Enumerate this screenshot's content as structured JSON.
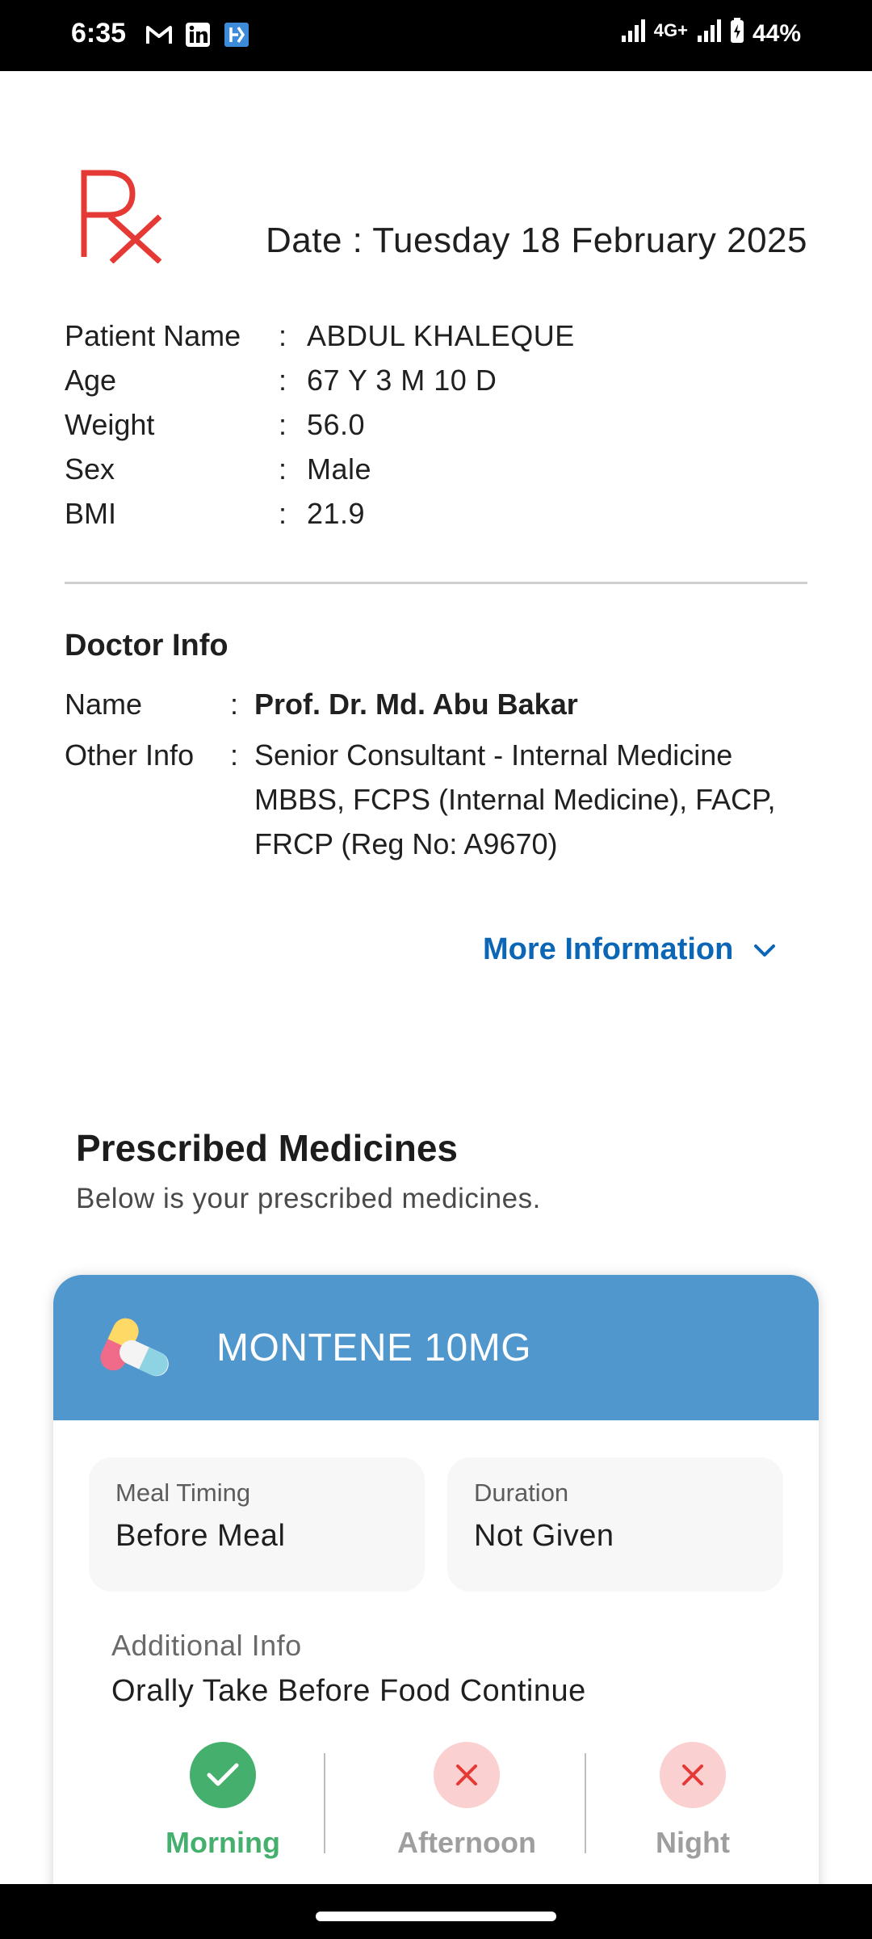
{
  "status_bar": {
    "time": "6:35",
    "network": "4G+",
    "battery": "44%",
    "app_icons": [
      "gmail-icon",
      "linkedin-icon",
      "app-icon"
    ]
  },
  "rx_symbol": "Rx",
  "date_line": "Date : Tuesday 18 February 2025",
  "patient": {
    "rows": [
      {
        "label": "Patient Name",
        "value": "ABDUL KHALEQUE"
      },
      {
        "label": "Age",
        "value": "67 Y 3 M 10 D"
      },
      {
        "label": "Weight",
        "value": "56.0"
      },
      {
        "label": "Sex",
        "value": "Male"
      },
      {
        "label": "BMI",
        "value": "21.9"
      }
    ]
  },
  "doctor": {
    "title": "Doctor Info",
    "name_label": "Name",
    "name": "Prof. Dr. Md. Abu Bakar",
    "other_label": "Other Info",
    "other_lines": [
      "Senior Consultant - Internal Medicine",
      "MBBS, FCPS (Internal Medicine), FACP,",
      "FRCP (Reg No: A9670)"
    ]
  },
  "more_info_label": "More Information",
  "prescribed": {
    "title": "Prescribed Medicines",
    "subtitle": "Below is your prescribed medicines."
  },
  "medicine": {
    "name": "MONTENE 10MG",
    "meal_timing_label": "Meal Timing",
    "meal_timing": "Before Meal",
    "duration_label": "Duration",
    "duration": "Not Given",
    "additional_label": "Additional Info",
    "additional": "Orally Take Before Food Continue",
    "schedule": [
      {
        "label": "Morning",
        "taken": true
      },
      {
        "label": "Afternoon",
        "taken": false
      },
      {
        "label": "Night",
        "taken": false
      }
    ]
  },
  "colors": {
    "accent_blue": "#0b66b5",
    "card_header": "#4f97cd",
    "rx_red": "#e53935",
    "taken_green": "#45b06d",
    "not_taken_red": "#e53935",
    "not_taken_bg": "#fbd0d0",
    "muted_label": "#9e9e9e"
  }
}
